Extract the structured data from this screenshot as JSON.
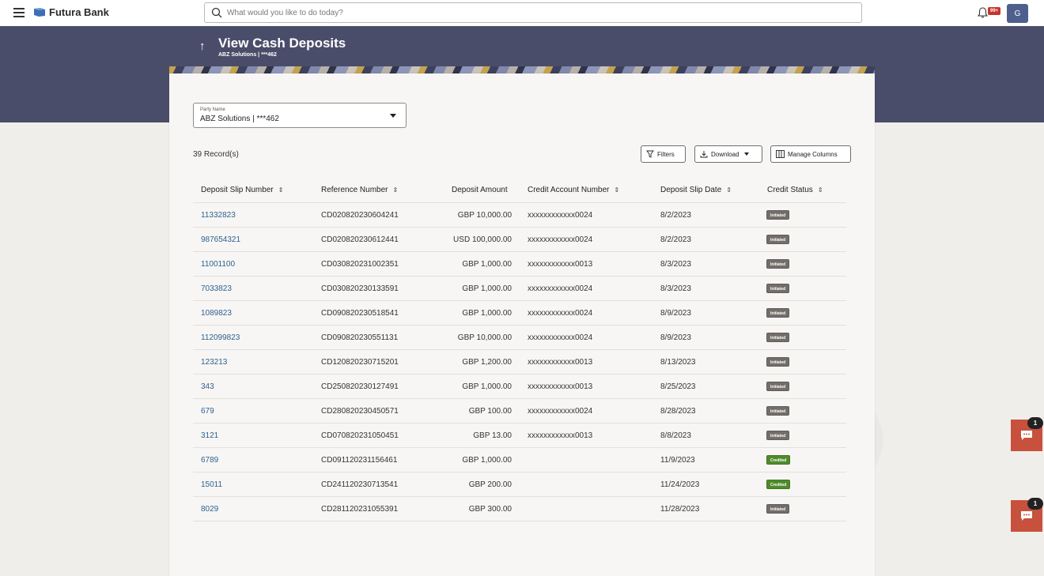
{
  "header": {
    "brand": "Futura Bank",
    "search_placeholder": "What would you like to do today?",
    "notification_badge": "99+",
    "avatar_initial": "G"
  },
  "page": {
    "title": "View Cash Deposits",
    "subtitle": "ABZ Solutions | ***462"
  },
  "filter": {
    "party_label": "Party Name",
    "party_value": "ABZ Solutions | ***462"
  },
  "toolbar": {
    "records": "39 Record(s)",
    "filters_label": "Filters",
    "download_label": "Download",
    "manage_columns_label": "Manage Columns"
  },
  "table": {
    "columns": [
      "Deposit Slip Number",
      "Reference Number",
      "Deposit Amount",
      "Credit Account Number",
      "Deposit Slip Date",
      "Credit Status"
    ],
    "rows": [
      {
        "slip": "11332823",
        "ref": "CD020820230604241",
        "amount": "GBP 10,000.00",
        "account": "xxxxxxxxxxxx0024",
        "date": "8/2/2023",
        "status": "Initiated"
      },
      {
        "slip": "987654321",
        "ref": "CD020820230612441",
        "amount": "USD 100,000.00",
        "account": "xxxxxxxxxxxx0024",
        "date": "8/2/2023",
        "status": "Initiated"
      },
      {
        "slip": "11001100",
        "ref": "CD030820231002351",
        "amount": "GBP 1,000.00",
        "account": "xxxxxxxxxxxx0013",
        "date": "8/3/2023",
        "status": "Initiated"
      },
      {
        "slip": "7033823",
        "ref": "CD030820230133591",
        "amount": "GBP 1,000.00",
        "account": "xxxxxxxxxxxx0024",
        "date": "8/3/2023",
        "status": "Initiated"
      },
      {
        "slip": "1089823",
        "ref": "CD090820230518541",
        "amount": "GBP 1,000.00",
        "account": "xxxxxxxxxxxx0024",
        "date": "8/9/2023",
        "status": "Initiated"
      },
      {
        "slip": "112099823",
        "ref": "CD090820230551131",
        "amount": "GBP 10,000.00",
        "account": "xxxxxxxxxxxx0024",
        "date": "8/9/2023",
        "status": "Initiated"
      },
      {
        "slip": "123213",
        "ref": "CD120820230715201",
        "amount": "GBP 1,200.00",
        "account": "xxxxxxxxxxxx0013",
        "date": "8/13/2023",
        "status": "Initiated"
      },
      {
        "slip": "343",
        "ref": "CD250820230127491",
        "amount": "GBP 1,000.00",
        "account": "xxxxxxxxxxxx0013",
        "date": "8/25/2023",
        "status": "Initiated"
      },
      {
        "slip": "679",
        "ref": "CD280820230450571",
        "amount": "GBP 100.00",
        "account": "xxxxxxxxxxxx0024",
        "date": "8/28/2023",
        "status": "Initiated"
      },
      {
        "slip": "3121",
        "ref": "CD070820231050451",
        "amount": "GBP 13.00",
        "account": "xxxxxxxxxxxx0013",
        "date": "8/8/2023",
        "status": "Initiated"
      },
      {
        "slip": "6789",
        "ref": "CD091120231156461",
        "amount": "GBP 1,000.00",
        "account": "",
        "date": "11/9/2023",
        "status": "Credited"
      },
      {
        "slip": "15011",
        "ref": "CD241120230713541",
        "amount": "GBP 200.00",
        "account": "",
        "date": "11/24/2023",
        "status": "Credited"
      },
      {
        "slip": "8029",
        "ref": "CD281120231055391",
        "amount": "GBP 300.00",
        "account": "",
        "date": "11/28/2023",
        "status": "Initiated"
      }
    ]
  },
  "status_colors": {
    "Initiated": "#736e69",
    "Credited": "#4f8a2b"
  },
  "chat": {
    "badge_1": "1",
    "badge_2": "1"
  }
}
